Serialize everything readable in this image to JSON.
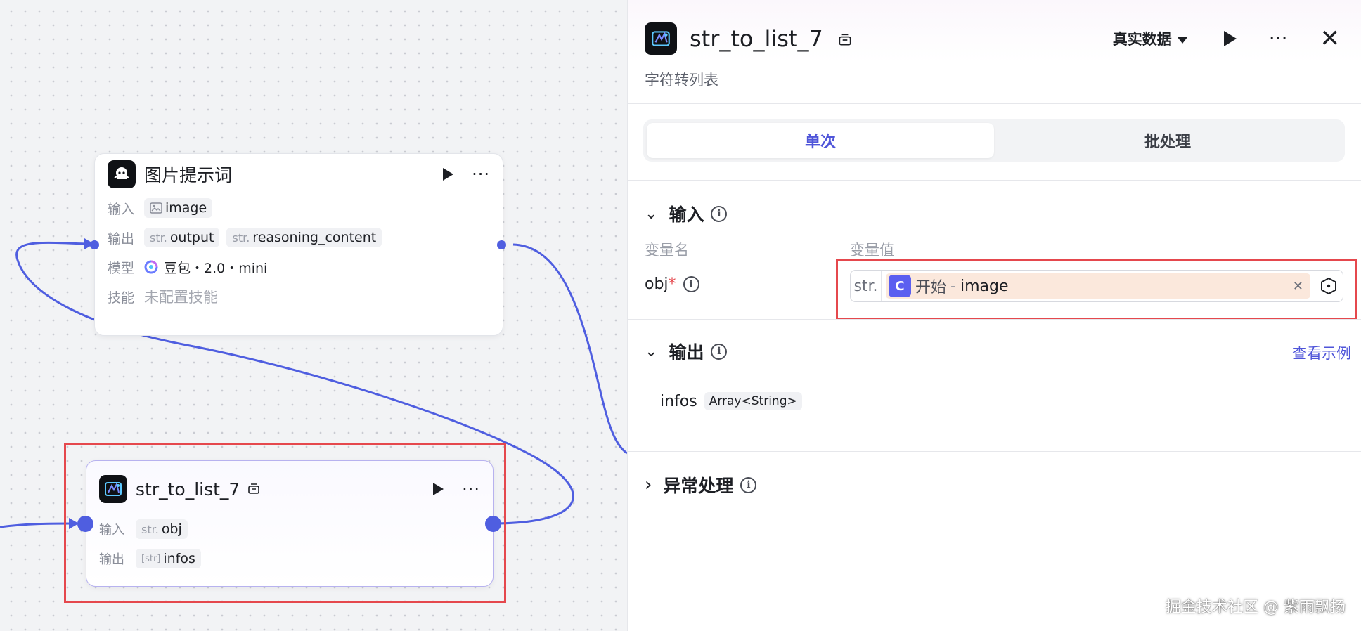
{
  "canvas": {
    "node_image_prompt": {
      "title": "图片提示词",
      "input_label": "输入",
      "output_label": "输出",
      "model_label": "模型",
      "skill_label": "技能",
      "inputs": [
        {
          "type": "",
          "name": "image"
        }
      ],
      "outputs": [
        {
          "type": "str.",
          "name": "output"
        },
        {
          "type": "str.",
          "name": "reasoning_content"
        }
      ],
      "model_value": "豆包・2.0・mini",
      "skill_value": "未配置技能"
    },
    "node_str_to_list": {
      "title": "str_to_list_7",
      "input_label": "输入",
      "output_label": "输出",
      "input": {
        "type": "str.",
        "name": "obj"
      },
      "output": {
        "type": "[str]",
        "name": "infos"
      }
    }
  },
  "panel": {
    "title": "str_to_list_7",
    "subtitle": "字符转列表",
    "mode_select": "真实数据",
    "tabs": [
      "单次",
      "批处理"
    ],
    "active_tab": 0,
    "input_section": {
      "title": "输入",
      "col_name": "变量名",
      "col_value": "变量值",
      "var_name": "obj",
      "required_mark": "*",
      "value_type": "str.",
      "value_source": "开始",
      "value_sep": "-",
      "value_field": "image"
    },
    "output_section": {
      "title": "输出",
      "example_link": "查看示例",
      "var_name": "infos",
      "var_type": "Array<String>"
    },
    "error_section": {
      "title": "异常处理"
    }
  },
  "watermark": "掘金技术社区 @ 紫雨飘扬",
  "colors": {
    "accent": "#4f55d9",
    "edge": "#4f5ee0",
    "highlight": "#e5484d",
    "ref_bg": "#fbe8dc"
  }
}
